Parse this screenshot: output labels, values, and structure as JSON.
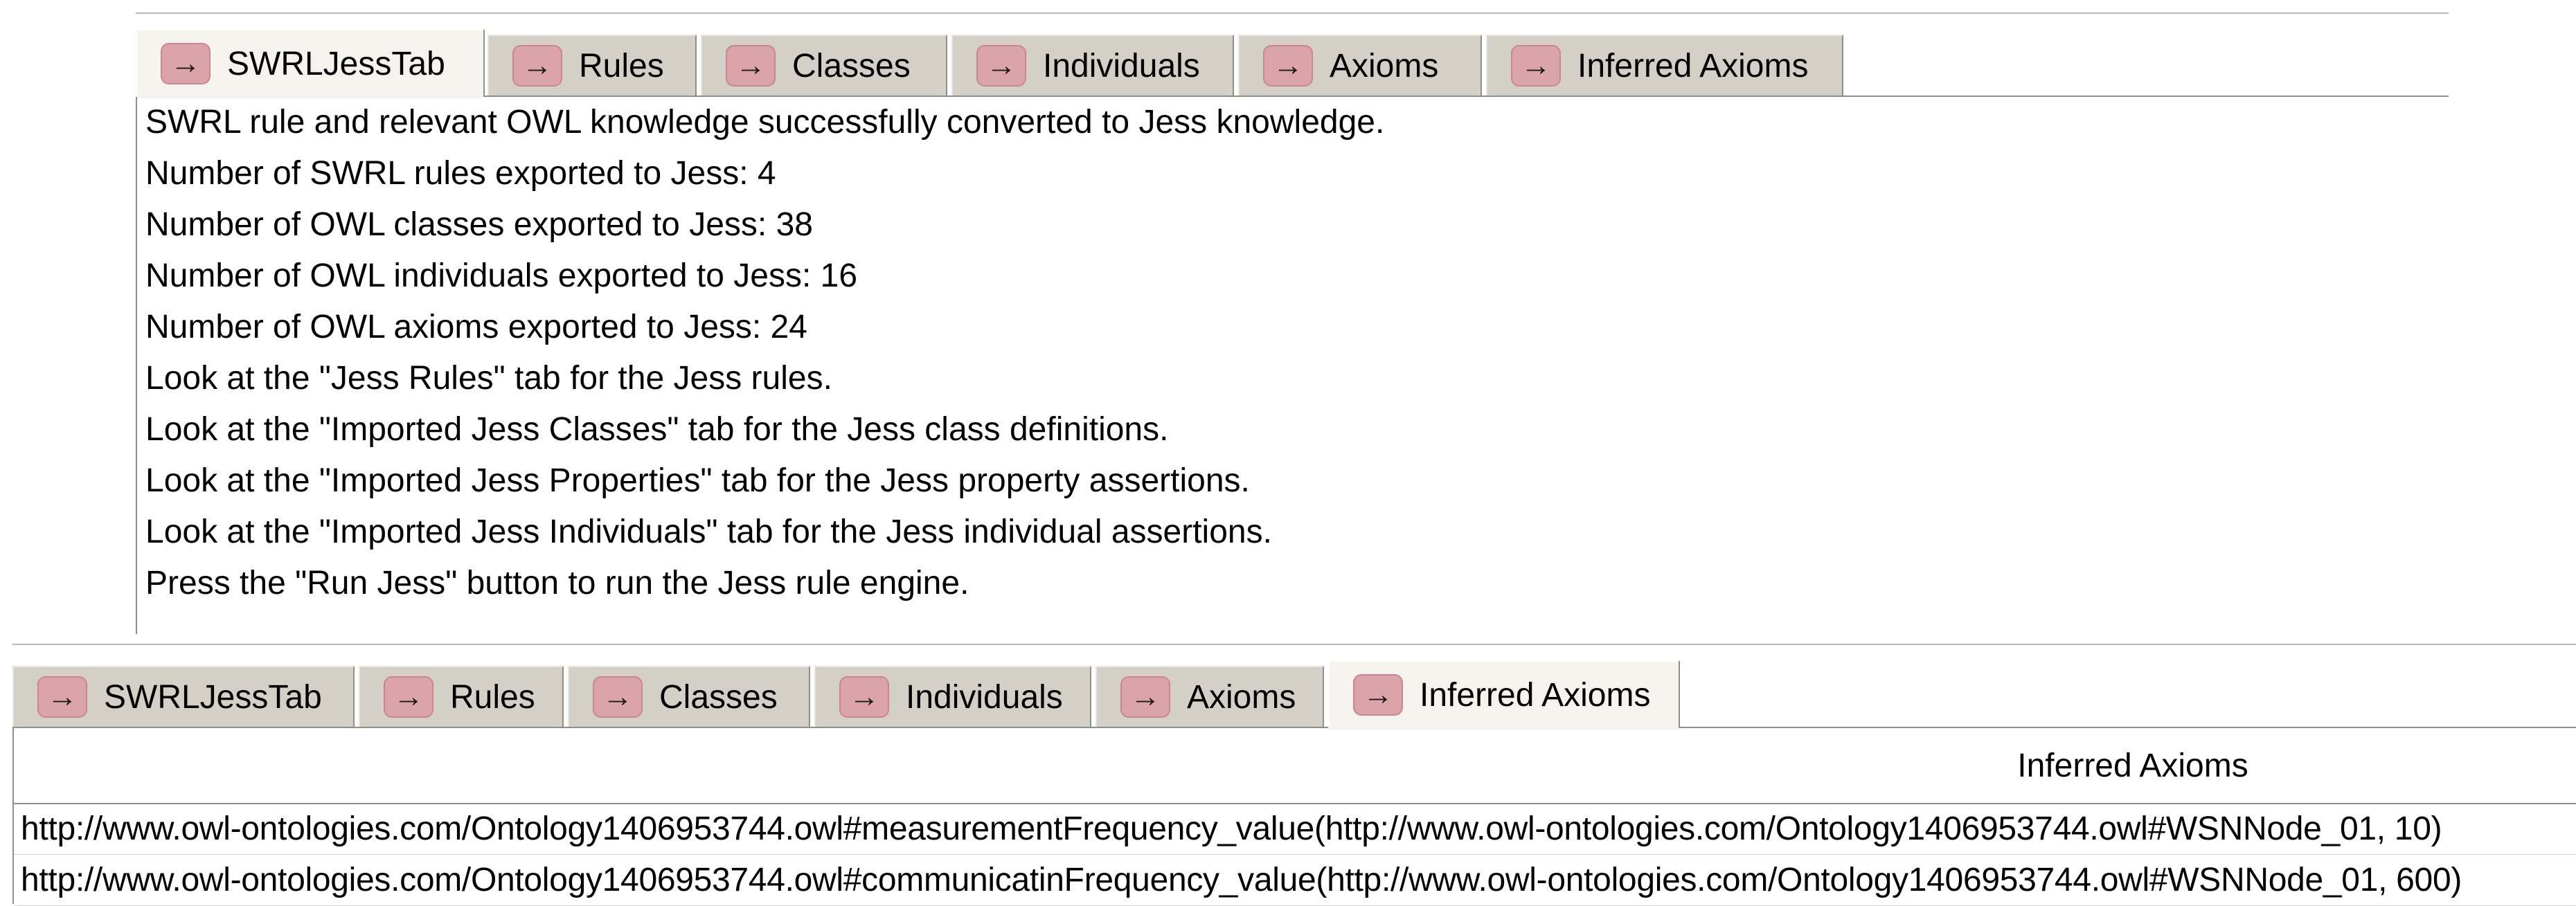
{
  "top_panel": {
    "tabs": [
      {
        "icon": "arrow-right-icon",
        "glyph": "→",
        "label": "SWRLJessTab",
        "selected": true
      },
      {
        "icon": "arrow-right-icon",
        "glyph": "→",
        "label": "Rules",
        "selected": false
      },
      {
        "icon": "arrow-right-icon",
        "glyph": "→",
        "label": "Classes",
        "selected": false
      },
      {
        "icon": "arrow-right-icon",
        "glyph": "→",
        "label": "Individuals",
        "selected": false
      },
      {
        "icon": "arrow-right-icon",
        "glyph": "→",
        "label": "Axioms",
        "selected": false
      },
      {
        "icon": "arrow-right-icon",
        "glyph": "→",
        "label": "Inferred Axioms",
        "selected": false
      }
    ],
    "messages": [
      "SWRL rule and relevant OWL knowledge successfully converted to Jess knowledge.",
      "Number of SWRL rules exported to Jess: 4",
      "Number of OWL classes exported to Jess: 38",
      "Number of OWL individuals exported to Jess: 16",
      "Number of OWL axioms exported to Jess: 24",
      "Look at the \"Jess Rules\" tab for the Jess rules.",
      "Look at the \"Imported Jess Classes\" tab for the Jess class definitions.",
      "Look at the \"Imported Jess Properties\" tab for the Jess property assertions.",
      "Look at the \"Imported Jess Individuals\" tab for the Jess individual assertions.",
      "Press the \"Run Jess\" button to run the Jess rule engine."
    ]
  },
  "bottom_panel": {
    "tabs": [
      {
        "icon": "arrow-right-icon",
        "glyph": "→",
        "label": "SWRLJessTab",
        "selected": false
      },
      {
        "icon": "arrow-right-icon",
        "glyph": "→",
        "label": "Rules",
        "selected": false
      },
      {
        "icon": "arrow-right-icon",
        "glyph": "→",
        "label": "Classes",
        "selected": false
      },
      {
        "icon": "arrow-right-icon",
        "glyph": "→",
        "label": "Individuals",
        "selected": false
      },
      {
        "icon": "arrow-right-icon",
        "glyph": "→",
        "label": "Axioms",
        "selected": false
      },
      {
        "icon": "arrow-right-icon",
        "glyph": "→",
        "label": "Inferred Axioms",
        "selected": true
      }
    ],
    "table": {
      "header": "Inferred Axioms",
      "rows": [
        "http://www.owl-ontologies.com/Ontology1406953744.owl#measurementFrequency_value(http://www.owl-ontologies.com/Ontology1406953744.owl#WSNNode_01, 10)",
        "http://www.owl-ontologies.com/Ontology1406953744.owl#communicatinFrequency_value(http://www.owl-ontologies.com/Ontology1406953744.owl#WSNNode_01, 600)"
      ]
    }
  },
  "colors": {
    "tab_background": "#d4d0c8",
    "tab_selected_background": "#f4f3ee",
    "tab_icon_fill": "#dba4a8",
    "border": "#8e8f87"
  }
}
